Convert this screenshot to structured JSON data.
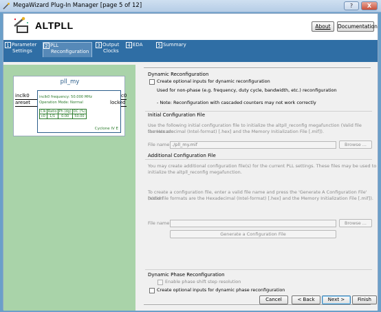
{
  "window": {
    "title": "MegaWizard Plug-In Manager [page 5 of 12]",
    "help_label": "?",
    "close_label": "X"
  },
  "header": {
    "title": "ALTPLL",
    "about_label": "About",
    "documentation_label": "Documentation"
  },
  "tabs": [
    {
      "num": "1",
      "label1": "Parameter",
      "label2": "Settings"
    },
    {
      "num": "2",
      "label1": "PLL",
      "label2": "Reconfiguration"
    },
    {
      "num": "3",
      "label1": "Output",
      "label2": "Clocks"
    },
    {
      "num": "4",
      "label1": "EDA",
      "label2": ""
    },
    {
      "num": "5",
      "label1": "Summary",
      "label2": ""
    }
  ],
  "symbol": {
    "title": "pll_my",
    "in_ports": [
      "inclk0",
      "areset"
    ],
    "out_ports": [
      "c0",
      "locked"
    ],
    "freq_text": "inclk0 frequency: 50.000 MHz",
    "mode_text": "Operation Mode: Normal",
    "table_headers": [
      "Clk",
      "Ratio",
      "Ph (dg)",
      "DC (%)"
    ],
    "table_row": [
      "c0",
      "1/1",
      "0.00",
      "50.00"
    ],
    "device": "Cyclone IV E"
  },
  "dynamic_reconfig": {
    "title": "Dynamic Reconfiguration",
    "checkbox_label": "Create optional inputs for dynamic reconfiguration",
    "line1": "Used for non-phase (e.g. frequency, duty cycle, bandwidth, etc.) reconfiguration",
    "line2": "- Note: Reconfiguration with cascaded counters may not work correctly"
  },
  "initial_config": {
    "title": "Initial Configuration File",
    "desc1": "Use the following initial configuration file to initialize the altpll_reconfig megafunction (Valid file formats are",
    "desc2": "the Hexadecimal (Intel-format) [.hex] and the Memory Initialization File [.mif]).",
    "file_label": "File name:",
    "file_value": "./pll_my.mif",
    "browse_label": "Browse ..."
  },
  "additional_config": {
    "title": "Additional Configuration File",
    "desc1": "You may create additional configuration file(s) for the current PLL settings. These files may be used to",
    "desc2": "initialize the altpll_reconfig megafunction.",
    "desc3": "To create a configuration file, enter a valid file name and press the 'Generate A Configuration File' button",
    "desc4": "(Valid file formats are the Hexadecimal (Intel-format) [.hex] and the Memory Initialization File [.mif]).",
    "file_label": "File name:",
    "file_value": "",
    "browse_label": "Browse ...",
    "generate_label": "Generate a Configuration File"
  },
  "dynamic_phase": {
    "title": "Dynamic Phase Reconfiguration",
    "enable_label": "Enable phase shift step resolution",
    "create_label": "Create optional inputs for dynamic phase reconfiguration"
  },
  "footer": {
    "cancel_label": "Cancel",
    "back_label": "< Back",
    "next_label": "Next >",
    "finish_label": "Finish"
  }
}
